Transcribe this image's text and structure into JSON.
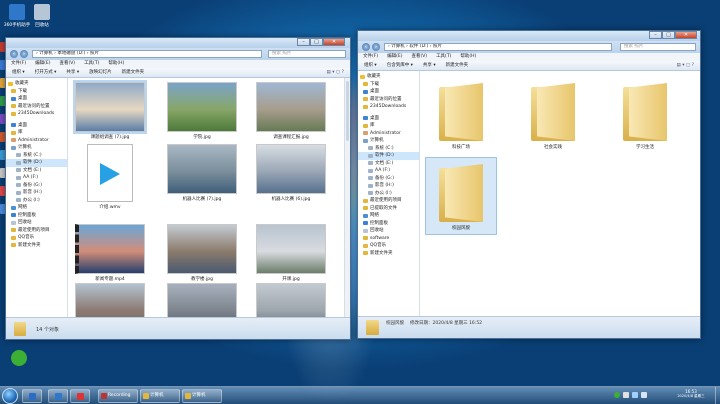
{
  "desktop": {
    "icons": [
      {
        "label": "360手机助手",
        "color": "#2f78c9"
      },
      {
        "label": "回收站",
        "color": "#b7c6d6"
      }
    ],
    "side_icons": [
      {
        "color": "#c63b2f"
      },
      {
        "color": "#3b7bd6"
      },
      {
        "color": "#e0a63a"
      },
      {
        "color": "#2f9d4c"
      },
      {
        "color": "#7c4bc4"
      },
      {
        "color": "#d25a2b"
      },
      {
        "color": "#3b9bd6"
      },
      {
        "color": "#c9c9c9"
      },
      {
        "color": "#e04848"
      },
      {
        "color": "#4b8de0"
      }
    ],
    "wechat_icon_color": "#3cb034"
  },
  "left_window": {
    "address": "› 计算机 › 本地磁盘 (D:) › 照片",
    "search_placeholder": "搜索 照片",
    "menu": [
      "文件(F)",
      "编辑(E)",
      "查看(V)",
      "工具(T)",
      "帮助(H)"
    ],
    "commands": [
      "组织 ▾",
      "打开方式 ▾",
      "共享 ▾",
      "放映幻灯片",
      "新建文件夹"
    ],
    "nav": [
      {
        "label": "收藏夹",
        "type": "star"
      },
      {
        "label": "下载",
        "type": "folder"
      },
      {
        "label": "桌面",
        "type": "blue"
      },
      {
        "label": "最近访问的位置",
        "type": "folder"
      },
      {
        "label": "2345Downloads",
        "type": "folder"
      },
      {
        "label": "",
        "type": "gap"
      },
      {
        "label": "桌面",
        "type": "blue"
      },
      {
        "label": "库",
        "type": "folder"
      },
      {
        "label": "Administrator",
        "type": "user"
      },
      {
        "label": "计算机",
        "type": "pc"
      },
      {
        "label": "系统 (C:)",
        "type": "drive"
      },
      {
        "label": "软件 (D:)",
        "type": "drive",
        "selected": true
      },
      {
        "label": "文档 (E:)",
        "type": "drive"
      },
      {
        "label": "AA (F:)",
        "type": "drive"
      },
      {
        "label": "备份 (G:)",
        "type": "drive"
      },
      {
        "label": "影音 (H:)",
        "type": "drive"
      },
      {
        "label": "办公 (I:)",
        "type": "drive"
      },
      {
        "label": "网络",
        "type": "net"
      },
      {
        "label": "控制面板",
        "type": "blue"
      },
      {
        "label": "回收站",
        "type": "bin"
      },
      {
        "label": "最近使用的项目",
        "type": "folder"
      },
      {
        "label": "QQ音乐",
        "type": "folder"
      },
      {
        "label": "新建文件夹",
        "type": "folder"
      }
    ],
    "items": [
      {
        "label": "课题组调查 (7).jpg",
        "colors": [
          "#8fa9c6",
          "#e7d8c2",
          "#5b7ea8"
        ],
        "selected": true
      },
      {
        "label": "学院.jpg",
        "colors": [
          "#7aa4c9",
          "#88a668",
          "#4c7a3a"
        ]
      },
      {
        "label": "调查课程汇报.jpg",
        "colors": [
          "#9fb8d4",
          "#a79d8c",
          "#667a55"
        ]
      },
      {
        "label": "介绍.wmv",
        "colors": [
          "#ffffff",
          "#ffffff",
          "#ffffff"
        ],
        "video": true
      },
      {
        "label": "机器人比赛 (7).jpg",
        "colors": [
          "#a9b7c4",
          "#7b8f9c",
          "#3f5e7a"
        ]
      },
      {
        "label": "机器人比赛 (6).jpg",
        "colors": [
          "#d8dde4",
          "#9aa7b6",
          "#56708e"
        ]
      },
      {
        "label": "新闻专题.mp4",
        "colors": [
          "#6aa6d6",
          "#d28d7a",
          "#253f6c"
        ],
        "movie": true
      },
      {
        "label": "教学楼.jpg",
        "colors": [
          "#c5cbd2",
          "#8b7b6c",
          "#4a5a70"
        ]
      },
      {
        "label": "开课.jpg",
        "colors": [
          "#b8c4d0",
          "#d9dbe0",
          "#6b7e6a"
        ]
      },
      {
        "label": "",
        "colors": [
          "#b3c2cf",
          "#8c7a72",
          "#5f6b55"
        ]
      },
      {
        "label": "",
        "colors": [
          "#a7b1bd",
          "#7e858e",
          "#4a5460"
        ]
      },
      {
        "label": "",
        "colors": [
          "#c2c9d1",
          "#9ea6ae",
          "#5a6571"
        ]
      }
    ],
    "status": "14 个对象"
  },
  "right_window": {
    "address": "› 计算机 › 软件 (D:) › 照片",
    "search_placeholder": "搜索 照片",
    "menu": [
      "文件(F)",
      "编辑(E)",
      "查看(V)",
      "工具(T)",
      "帮助(H)"
    ],
    "commands": [
      "组织 ▾",
      "包含到库中 ▾",
      "共享 ▾",
      "新建文件夹"
    ],
    "nav": [
      {
        "label": "收藏夹",
        "type": "star"
      },
      {
        "label": "下载",
        "type": "folder"
      },
      {
        "label": "桌面",
        "type": "blue"
      },
      {
        "label": "最近访问的位置",
        "type": "folder"
      },
      {
        "label": "2345Downloads",
        "type": "folder"
      },
      {
        "label": "",
        "type": "gap"
      },
      {
        "label": "桌面",
        "type": "blue"
      },
      {
        "label": "库",
        "type": "folder"
      },
      {
        "label": "Administrator",
        "type": "user"
      },
      {
        "label": "计算机",
        "type": "pc"
      },
      {
        "label": "系统 (C:)",
        "type": "drive"
      },
      {
        "label": "软件 (D:)",
        "type": "drive",
        "selected": true
      },
      {
        "label": "文档 (E:)",
        "type": "drive"
      },
      {
        "label": "AA (F:)",
        "type": "drive"
      },
      {
        "label": "备份 (G:)",
        "type": "drive"
      },
      {
        "label": "影音 (H:)",
        "type": "drive"
      },
      {
        "label": "办公 (I:)",
        "type": "drive"
      },
      {
        "label": "最近使用的项目",
        "type": "folder"
      },
      {
        "label": "已提取的文件",
        "type": "folder"
      },
      {
        "label": "网络",
        "type": "net"
      },
      {
        "label": "控制面板",
        "type": "blue"
      },
      {
        "label": "回收站",
        "type": "bin"
      },
      {
        "label": "software",
        "type": "folder"
      },
      {
        "label": "QQ音乐",
        "type": "folder"
      },
      {
        "label": "新建文件夹",
        "type": "folder"
      }
    ],
    "folders": [
      {
        "label": "科技广场"
      },
      {
        "label": "社会实践"
      },
      {
        "label": "学习生活"
      },
      {
        "label": "校园风貌",
        "selected": true
      }
    ],
    "status_name": "校园风貌",
    "status_detail": "修改日期：2020/4/8 星期三 16:52"
  },
  "taskbar": {
    "buttons": [
      {
        "label": "",
        "color": "#2b6cc4"
      },
      {
        "label": "",
        "color": "#2f78c9"
      },
      {
        "label": "",
        "color": "#d33"
      },
      {
        "label": "",
        "color": "#e8a23a"
      },
      {
        "label": "Recording",
        "color": "#b33"
      },
      {
        "label": "计算机",
        "color": "#e2b83c"
      },
      {
        "label": "计算机",
        "color": "#e2b83c"
      }
    ],
    "time": "16:53",
    "date": "2020/4/8 星期三"
  }
}
